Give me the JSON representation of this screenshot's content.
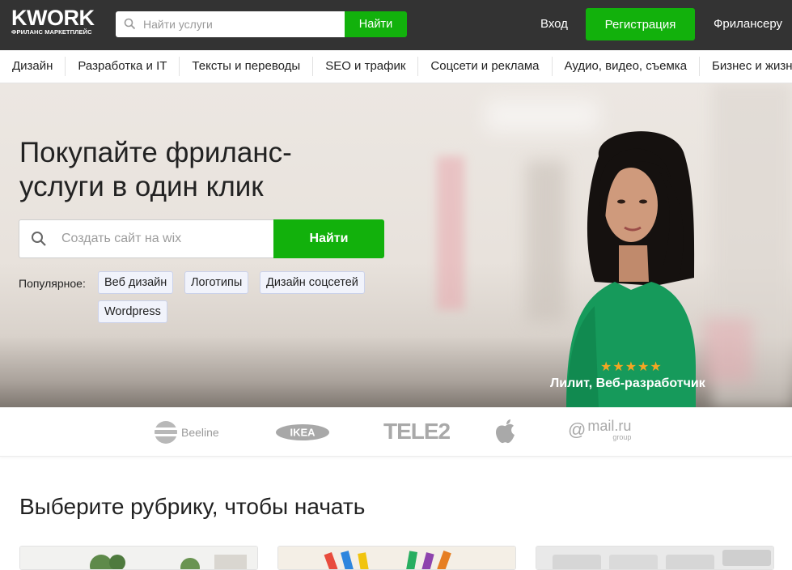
{
  "header": {
    "logo_word": "KWORK",
    "logo_tag": "ФРИЛАНС МАРКЕТПЛЕЙС",
    "search_placeholder": "Найти услуги",
    "search_button": "Найти",
    "login": "Вход",
    "register": "Регистрация",
    "freelancer": "Фрилансеру"
  },
  "categories": [
    "Дизайн",
    "Разработка и IT",
    "Тексты и переводы",
    "SEO и трафик",
    "Соцсети и реклама",
    "Аудио, видео, съемка",
    "Бизнес и жизнь"
  ],
  "hero": {
    "title": "Покупайте фриланс-услуги в один клик",
    "search_placeholder": "Создать сайт на wix",
    "search_button": "Найти",
    "popular_label": "Популярное:",
    "popular_tags": [
      "Веб дизайн",
      "Логотипы",
      "Дизайн соцсетей",
      "Wordpress"
    ],
    "rating_stars": 5,
    "person_caption": "Лилит, Веб-разработчик"
  },
  "brands": [
    {
      "name": "Beeline",
      "icon": "beeline-logo-icon"
    },
    {
      "name": "IKEA",
      "icon": "ikea-logo-icon"
    },
    {
      "name": "TELE2",
      "icon": "tele2-logo-icon"
    },
    {
      "name": "Apple",
      "icon": "apple-logo-icon"
    },
    {
      "name": "mail.ru",
      "sub": "group",
      "icon": "mailru-logo-icon"
    }
  ],
  "section": {
    "title": "Выберите рубрику, чтобы начать"
  },
  "colors": {
    "header_bg": "#333333",
    "accent_green": "#12b10c",
    "tag_bg": "#f1f3fb",
    "star": "#f5a623"
  }
}
